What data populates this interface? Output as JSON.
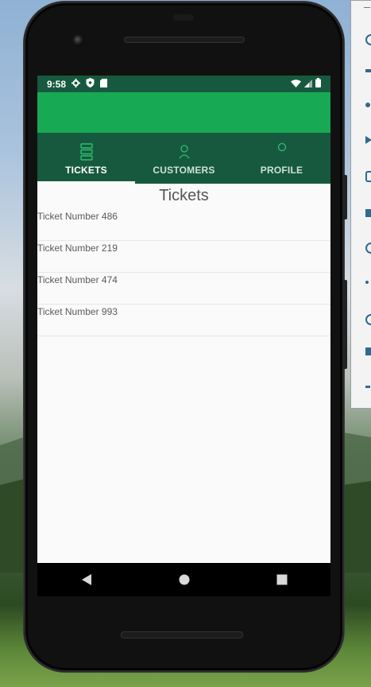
{
  "status_bar": {
    "time": "9:58",
    "left_icons": [
      "gear-icon",
      "shield-icon",
      "sd-card-icon"
    ],
    "right_icons": [
      "wifi-icon",
      "signal-icon",
      "battery-icon"
    ]
  },
  "tabs": [
    {
      "label": "TICKETS",
      "icon": "list-icon",
      "active": true
    },
    {
      "label": "CUSTOMERS",
      "icon": "person-icon",
      "active": false
    },
    {
      "label": "PROFILE",
      "icon": "circle-icon",
      "active": false
    }
  ],
  "page": {
    "title": "Tickets"
  },
  "tickets": [
    {
      "label": "Ticket Number 486"
    },
    {
      "label": "Ticket Number 219"
    },
    {
      "label": "Ticket Number 474"
    },
    {
      "label": "Ticket Number 993"
    }
  ],
  "colors": {
    "status_bar": "#17593f",
    "app_bar": "#18a955",
    "tab_bar": "#17593f",
    "tab_icon": "#2fbf6f"
  }
}
